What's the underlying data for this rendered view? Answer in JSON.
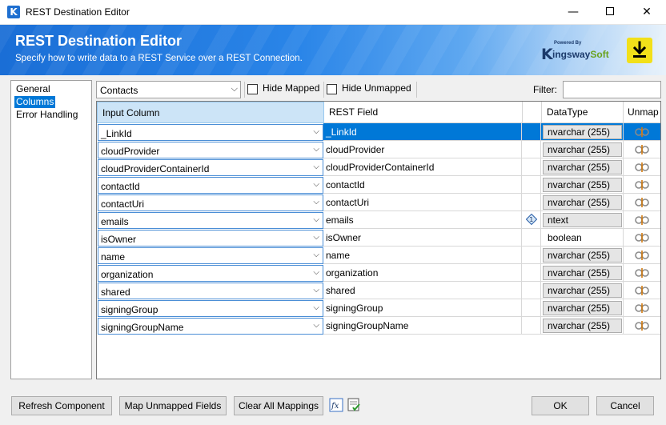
{
  "window": {
    "title": "REST Destination Editor",
    "app_icon": "K",
    "minimize": "—",
    "close": "✕"
  },
  "header": {
    "title": "REST Destination Editor",
    "subtitle": "Specify how to write data to a REST Service over a REST Connection.",
    "logo": {
      "powered_by": "Powered By",
      "brand_a": "ingsway",
      "brand_b": "Soft",
      "brand_k": "K"
    },
    "download_icon": "download-icon",
    "colors": {
      "banner": "#1a6ed6",
      "download": "#f2e01a"
    }
  },
  "nav": {
    "items": [
      {
        "label": "General",
        "selected": false
      },
      {
        "label": "Columns",
        "selected": true
      },
      {
        "label": "Error Handling",
        "selected": false
      }
    ]
  },
  "toolbar": {
    "object_select": "Contacts",
    "hide_mapped": "Hide Mapped",
    "hide_unmapped": "Hide Unmapped",
    "filter_label": "Filter:",
    "filter_value": ""
  },
  "grid": {
    "headers": {
      "input": "Input Column",
      "field": "REST Field",
      "datatype": "DataType",
      "unmap": "Unmap"
    },
    "rows": [
      {
        "input": "_LinkId",
        "field": "_LinkId",
        "datatype": "nvarchar (255)",
        "selected": true
      },
      {
        "input": "cloudProvider",
        "field": "cloudProvider",
        "datatype": "nvarchar (255)"
      },
      {
        "input": "cloudProviderContainerId",
        "field": "cloudProviderContainerId",
        "datatype": "nvarchar (255)"
      },
      {
        "input": "contactId",
        "field": "contactId",
        "datatype": "nvarchar (255)"
      },
      {
        "input": "contactUri",
        "field": "contactUri",
        "datatype": "nvarchar (255)"
      },
      {
        "input": "emails",
        "field": "emails",
        "datatype": "ntext",
        "field_icon": "array-icon"
      },
      {
        "input": "isOwner",
        "field": "isOwner",
        "datatype": "boolean",
        "plain_type": true
      },
      {
        "input": "name",
        "field": "name",
        "datatype": "nvarchar (255)"
      },
      {
        "input": "organization",
        "field": "organization",
        "datatype": "nvarchar (255)"
      },
      {
        "input": "shared",
        "field": "shared",
        "datatype": "nvarchar (255)"
      },
      {
        "input": "signingGroup",
        "field": "signingGroup",
        "datatype": "nvarchar (255)"
      },
      {
        "input": "signingGroupName",
        "field": "signingGroupName",
        "datatype": "nvarchar (255)"
      }
    ]
  },
  "footer": {
    "refresh": "Refresh Component",
    "map_unmapped": "Map Unmapped Fields",
    "clear_all": "Clear All Mappings",
    "fx_icon": "expression-icon",
    "doc_icon": "document-check-icon",
    "ok": "OK",
    "cancel": "Cancel"
  }
}
